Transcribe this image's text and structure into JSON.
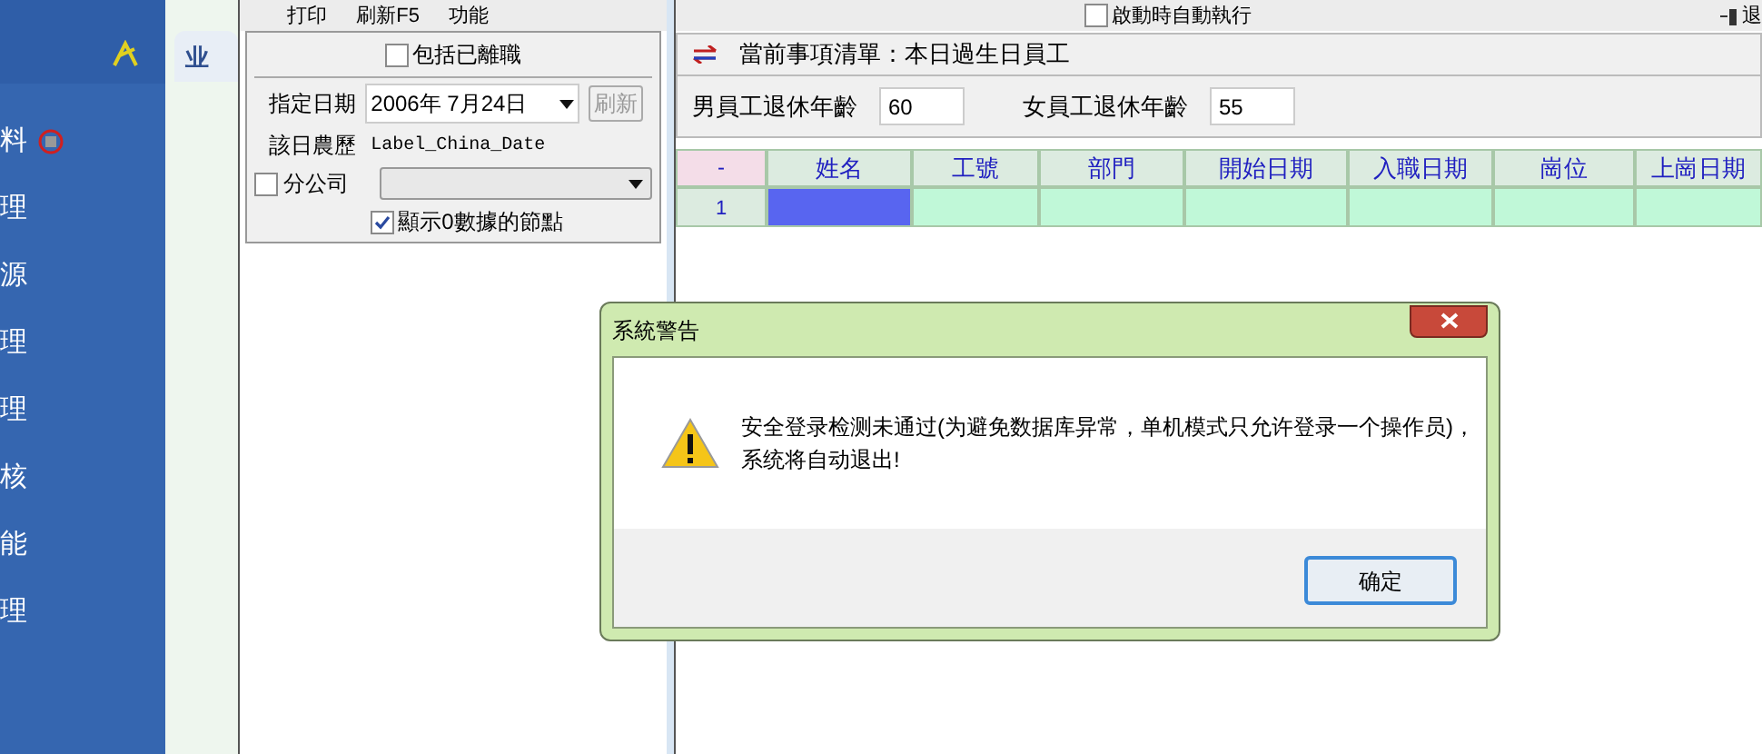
{
  "sidebar": {
    "items": [
      {
        "label": "料"
      },
      {
        "label": "理"
      },
      {
        "label": "源"
      },
      {
        "label": "理"
      },
      {
        "label": "理"
      },
      {
        "label": "核"
      },
      {
        "label": "能"
      },
      {
        "label": "理"
      }
    ]
  },
  "tab": {
    "label": "业"
  },
  "toolbar": {
    "buttons": [
      {
        "label": "打印"
      },
      {
        "label": "刷新F5"
      },
      {
        "label": "功能"
      }
    ],
    "autorun": {
      "label": "啟動時自動執行",
      "checked": false
    },
    "exit": {
      "label": "退"
    }
  },
  "filter": {
    "include_resigned": {
      "label": "包括已離職",
      "checked": false
    },
    "date_label": "指定日期",
    "date_value": "2006年  7月24日",
    "refresh": "刷新",
    "lunar_label": "該日農歷",
    "lunar_value": "Label_China_Date",
    "branch": {
      "label": "分公司",
      "checked": false
    },
    "show_zero": {
      "label": "顯示0數據的節點",
      "checked": true
    }
  },
  "list": {
    "title": "當前事項清單：本日過生日員工",
    "male_label": "男員工退休年齡",
    "male_value": "60",
    "female_label": "女員工退休年齡",
    "female_value": "55"
  },
  "table": {
    "corner": "-",
    "columns": [
      "姓名",
      "工號",
      "部門",
      "開始日期",
      "入職日期",
      "崗位",
      "上崗日期"
    ],
    "rows": [
      {
        "number": "1"
      }
    ]
  },
  "dialog": {
    "title": "系統警告",
    "message": "安全登录检测未通过(为避免数据库异常，单机模式只允许登录一个操作员)，系统将自动退出!",
    "ok": "确定"
  }
}
